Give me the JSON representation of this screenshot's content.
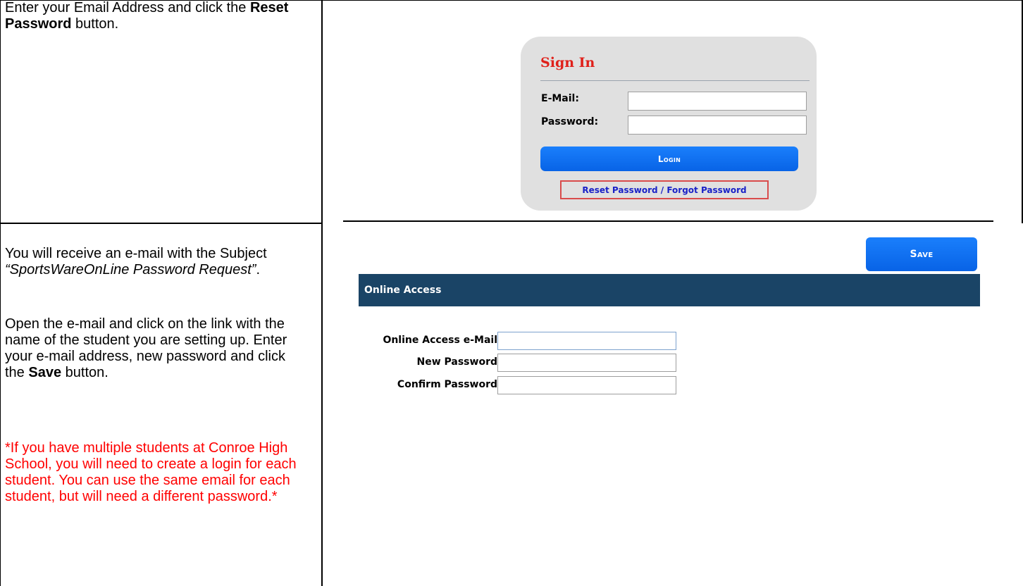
{
  "row1": {
    "instruction_pre": "Enter your Email Address and click the ",
    "instruction_bold": "Reset Password",
    "instruction_post": " button."
  },
  "signin": {
    "title": "Sign In",
    "email_label": "E-Mail:",
    "password_label": "Password:",
    "email_value": "",
    "password_value": "",
    "login_label": "Login",
    "reset_link": "Reset Password / Forgot Password"
  },
  "row2": {
    "para1_pre": "You will receive an e-mail with the Subject ",
    "para1_italic": "“SportsWareOnLine Password Request”",
    "para1_post": ".",
    "para2_pre": "Open the e-mail and click on the link with the name of the student you are setting up. Enter your e-mail address, new password and click the ",
    "para2_bold": "Save",
    "para2_post": " button.",
    "note": "*If you have multiple students at Conroe High School, you will need to create a login for each student. You can use the same email for each student, but will need a different password.*"
  },
  "online_access": {
    "save_label": "Save",
    "header": "Online Access",
    "email_label": "Online Access e-Mail",
    "new_password_label": "New Password",
    "confirm_password_label": "Confirm Password",
    "email_value": "",
    "new_password_value": "",
    "confirm_password_value": ""
  },
  "colors": {
    "accent_blue": "#0a6cf0",
    "header_navy": "#1a4466",
    "title_red": "#e0201a",
    "note_red": "#ff0000"
  }
}
